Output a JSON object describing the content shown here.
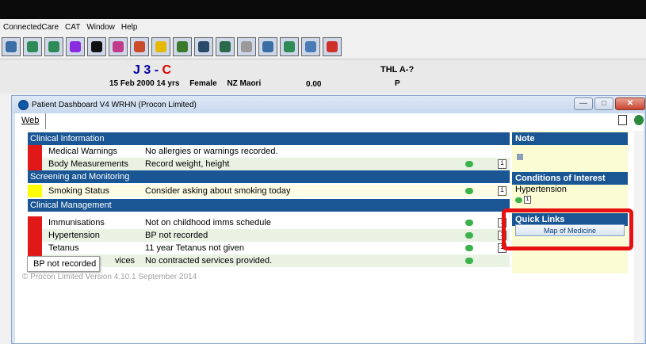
{
  "menu": {
    "items": [
      "ConnectedCare",
      "CAT",
      "Window",
      "Help"
    ]
  },
  "toolbar": {
    "icons": [
      {
        "name": "pen-icon",
        "color": "#3a6ea5"
      },
      {
        "name": "patient-icon",
        "color": "#2e8b57"
      },
      {
        "name": "lab-icon",
        "color": "#2e8b57"
      },
      {
        "name": "medication-icon",
        "color": "#8a2be2"
      },
      {
        "name": "close-box-icon",
        "color": "#111111"
      },
      {
        "name": "chart-icon",
        "color": "#c23a8a"
      },
      {
        "name": "users-icon",
        "color": "#c94b2a"
      },
      {
        "name": "bulb-icon",
        "color": "#e6b800"
      },
      {
        "name": "med-icon",
        "color": "#3a7a2a"
      },
      {
        "name": "notes-icon",
        "color": "#2a4a6a"
      },
      {
        "name": "docs-icon",
        "color": "#2a6a4a"
      },
      {
        "name": "refresh-icon",
        "color": "#9a9a9a"
      },
      {
        "name": "calculator-icon",
        "color": "#3a6ea5"
      },
      {
        "name": "building-icon",
        "color": "#2e8b57"
      },
      {
        "name": "form-icon",
        "color": "#4a7ab5"
      },
      {
        "name": "eraser-icon",
        "color": "#d0302a"
      }
    ]
  },
  "patient": {
    "name": "J 3 - ",
    "name_suffix": "C",
    "dob": "15 Feb 2000 14 yrs",
    "gender": "Female",
    "ethnicity": "NZ Maori",
    "amount": "0.00",
    "thl": "THL A-?",
    "thl_code": "P"
  },
  "window": {
    "title": "Patient Dashboard V4 WRHN (Procon Limited)",
    "tab": "Web"
  },
  "sections": {
    "clinical": "Clinical Information",
    "screening": "Screening and Monitoring",
    "management": "Clinical Management"
  },
  "rows": {
    "med_warn_label": "Medical Warnings",
    "med_warn_value": "No allergies or warnings recorded.",
    "body_label": "Body Measurements",
    "body_value": "Record weight, height",
    "smoke_label": "Smoking Status",
    "smoke_value": "Consider asking about smoking today",
    "imm_label": "Immunisations",
    "imm_value": "Not on childhood imms schedule",
    "hyp_label": "Hypertension",
    "hyp_value": "BP not recorded",
    "tet_label": "Tetanus",
    "tet_value": "11 year Tetanus not given",
    "svc_label": "vices",
    "svc_value": "No contracted services provided."
  },
  "sidebar": {
    "note_head": "Note",
    "coi_head": "Conditions of Interest",
    "coi_item": "Hypertension",
    "ql_head": "Quick Links",
    "ql_button": "Map of Medicine"
  },
  "tooltip": "BP not recorded",
  "footer": "© Procon Limited Version 4.10.1 September 2014",
  "colors": {
    "red": "#e01818",
    "yellow": "#ffff00",
    "header": "#1a5694"
  }
}
